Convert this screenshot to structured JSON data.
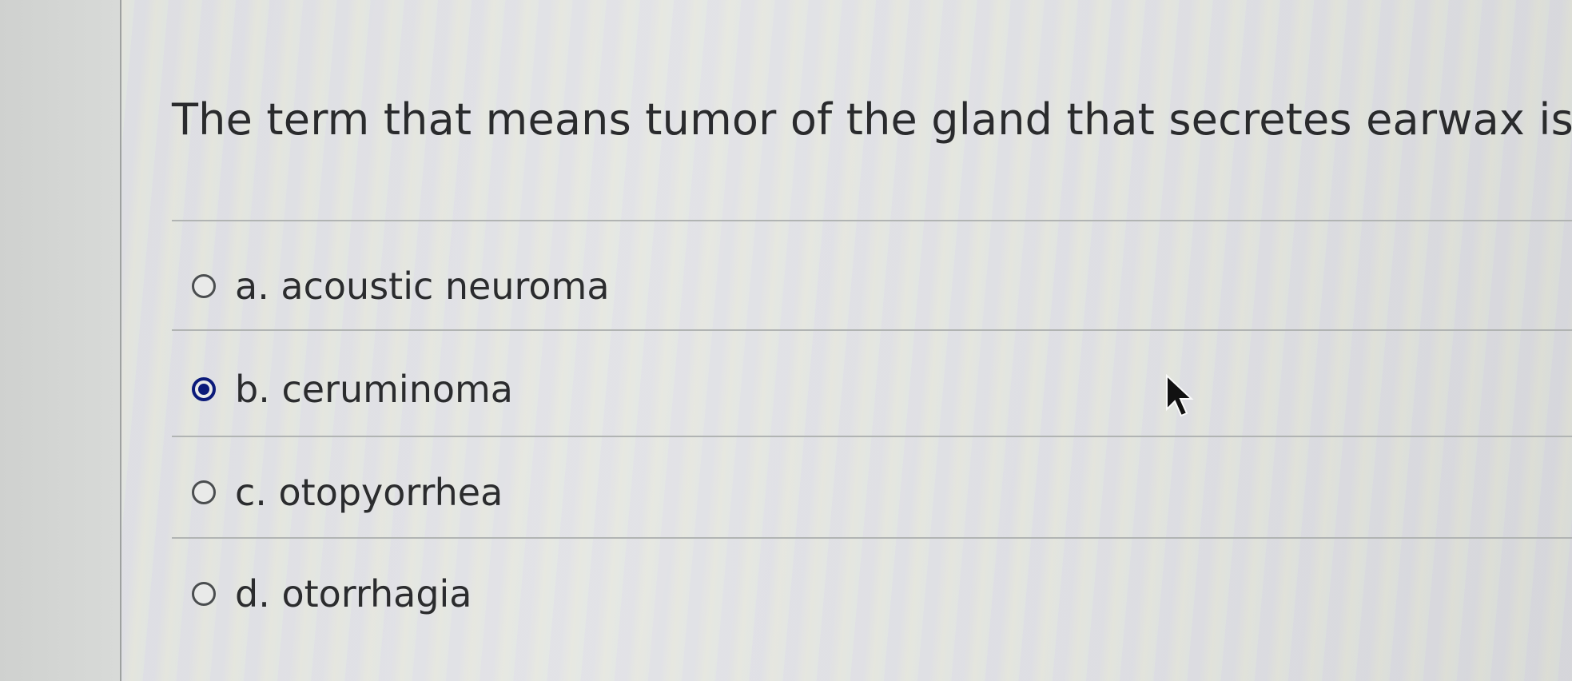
{
  "question": {
    "text": "The term that means tumor of the gland that secretes earwax is"
  },
  "options": [
    {
      "label": "a. acoustic neuroma",
      "selected": false
    },
    {
      "label": "b. ceruminoma",
      "selected": true
    },
    {
      "label": "c. otopyorrhea",
      "selected": false
    },
    {
      "label": "d. otorrhagia",
      "selected": false
    }
  ],
  "colors": {
    "selected_radio": "#0b1a7a",
    "text": "#2b2c2e"
  },
  "icons": {
    "cursor": "mouse-pointer-icon",
    "radio": "radio-button-icon"
  }
}
